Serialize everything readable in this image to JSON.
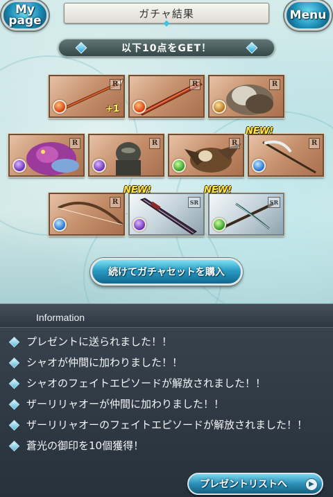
{
  "header": {
    "title": "ガチャ結果",
    "mypage_label_1": "My",
    "mypage_label_2": "page",
    "menu_label": "Menu"
  },
  "banner": {
    "text": "以下10点をGET！"
  },
  "items": [
    {
      "rarity": "R",
      "element": "fire",
      "icon": "spear-icon",
      "plus": "+1",
      "new": ""
    },
    {
      "rarity": "R",
      "element": "fire",
      "icon": "sword-icon",
      "plus": "",
      "new": ""
    },
    {
      "rarity": "R",
      "element": "earth",
      "icon": "bird-beast-icon",
      "plus": "",
      "new": ""
    },
    {
      "rarity": "R",
      "element": "dark",
      "icon": "purple-beast-icon",
      "plus": "",
      "new": ""
    },
    {
      "rarity": "R",
      "element": "dark",
      "icon": "armored-knight-icon",
      "plus": "",
      "new": ""
    },
    {
      "rarity": "R",
      "element": "wind",
      "icon": "griffin-icon",
      "plus": "",
      "new": ""
    },
    {
      "rarity": "R",
      "element": "water",
      "icon": "scythe-icon",
      "plus": "",
      "new": "NEW!"
    },
    {
      "rarity": "R",
      "element": "water",
      "icon": "bow-icon",
      "plus": "",
      "new": ""
    },
    {
      "rarity": "SR",
      "element": "dark",
      "icon": "dark-sword-icon",
      "plus": "",
      "new": "NEW!"
    },
    {
      "rarity": "SR",
      "element": "wind",
      "icon": "crossbow-icon",
      "plus": "",
      "new": "NEW!"
    }
  ],
  "buy_button": {
    "label": "続けてガチャセットを購入"
  },
  "information": {
    "title": "Information",
    "lines": [
      "プレゼントに送られました！！",
      "シャオが仲間に加わりました！！",
      "シャオのフェイトエピソードが解放されました！！",
      "ザーリリャオーが仲間に加わりました！！",
      "ザーリリャオーのフェイトエピソードが解放されました！！",
      "蒼光の御印を10個獲得！"
    ],
    "present_button": "プレゼントリストへ"
  },
  "colors": {
    "accent": "#2a9cc4",
    "new_tag": "#ffe34a",
    "panel_bg": "#2e3842"
  }
}
